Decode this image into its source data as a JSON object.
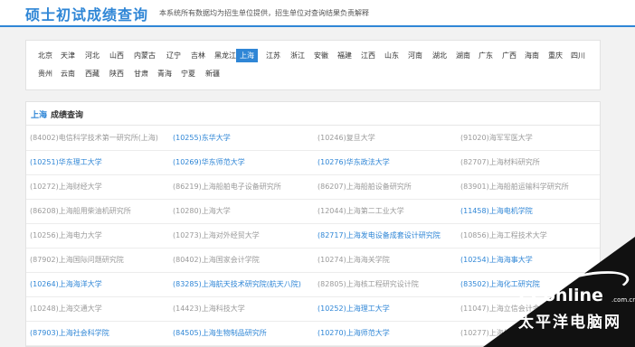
{
  "header": {
    "title": "硕士初试成绩查询",
    "notice": "本系统所有数据均为招生单位提供，招生单位对查询结果负责解释"
  },
  "provinces": {
    "row1": [
      "北京",
      "天津",
      "河北",
      "山西",
      "内蒙古",
      "辽宁",
      "吉林",
      "黑龙江",
      "上海",
      "江苏",
      "浙江",
      "安徽",
      "福建",
      "江西",
      "山东",
      "河南",
      "湖北",
      "湖南",
      "广东",
      "广西",
      "海南",
      "重庆",
      "四川"
    ],
    "row2": [
      "贵州",
      "云南",
      "西藏",
      "陕西",
      "甘肃",
      "青海",
      "宁夏",
      "新疆"
    ],
    "active": "上海"
  },
  "results": {
    "heading_province": "上海",
    "heading_text": "成绩查询",
    "rows": [
      [
        "(84002)电信科学技术第一研究所(上海)",
        "(10255)东华大学",
        "(10246)复旦大学",
        "(91020)海军军医大学"
      ],
      [
        "(10251)华东理工大学",
        "(10269)华东师范大学",
        "(10276)华东政法大学",
        "(82707)上海材料研究所"
      ],
      [
        "(10272)上海财经大学",
        "(86219)上海船舶电子设备研究所",
        "(86207)上海船舶设备研究所",
        "(83901)上海船舶运输科学研究所"
      ],
      [
        "(86208)上海船用柴油机研究所",
        "(10280)上海大学",
        "(12044)上海第二工业大学",
        "(11458)上海电机学院"
      ],
      [
        "(10256)上海电力大学",
        "(10273)上海对外经贸大学",
        "(82717)上海发电设备成套设计研究院",
        "(10856)上海工程技术大学"
      ],
      [
        "(87902)上海国际问题研究院",
        "(80402)上海国家会计学院",
        "(10274)上海海关学院",
        "(10254)上海海事大学"
      ],
      [
        "(10264)上海海洋大学",
        "(83285)上海航天技术研究院(航天八院)",
        "(82805)上海核工程研究设计院",
        "(83502)上海化工研究院"
      ],
      [
        "(10248)上海交通大学",
        "(14423)上海科技大学",
        "(10252)上海理工大学",
        "(11047)上海立信会计金融学院"
      ],
      [
        "(87903)上海社会科学院",
        "(84505)上海生物制品研究所",
        "(10270)上海师范大学",
        "(10277)上海体育学院"
      ]
    ],
    "highlight": [
      [
        "gray",
        "blue",
        "gray",
        "gray"
      ],
      [
        "blue",
        "blue",
        "blue",
        "gray"
      ],
      [
        "gray",
        "gray",
        "gray",
        "gray"
      ],
      [
        "gray",
        "gray",
        "gray",
        "blue"
      ],
      [
        "gray",
        "gray",
        "blue",
        "gray"
      ],
      [
        "gray",
        "gray",
        "gray",
        "blue"
      ],
      [
        "blue",
        "blue",
        "gray",
        "blue"
      ],
      [
        "gray",
        "gray",
        "blue",
        "gray"
      ],
      [
        "blue",
        "blue",
        "blue",
        "gray"
      ]
    ]
  },
  "colors": {
    "accent": "#2f86d6",
    "muted": "#9a9a9a"
  },
  "watermark": {
    "brand": "PConline",
    "domain": ".com.cn",
    "cn": "太平洋电脑网"
  }
}
